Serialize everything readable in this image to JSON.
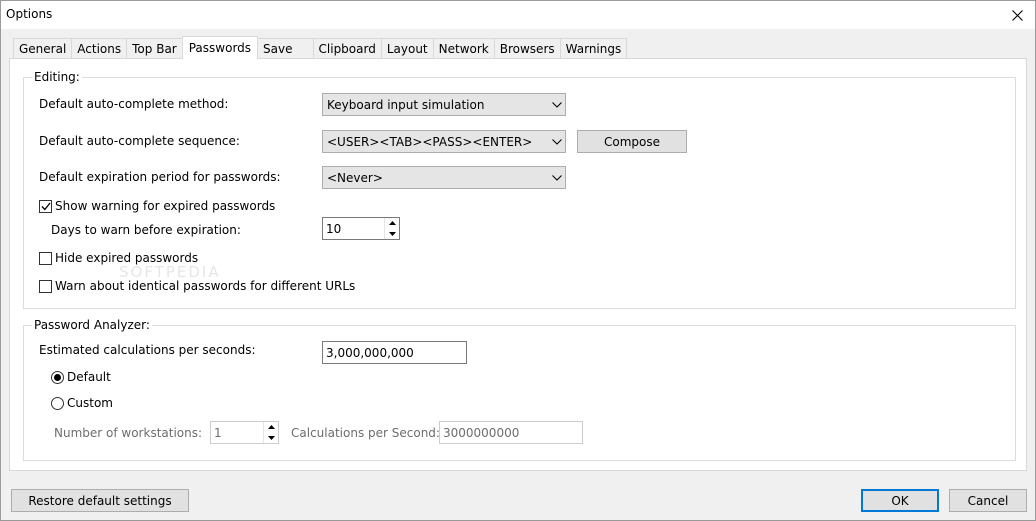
{
  "window": {
    "title": "Options"
  },
  "tabs": [
    {
      "label": "General",
      "active": false
    },
    {
      "label": "Actions",
      "active": false
    },
    {
      "label": "Top Bar",
      "active": false
    },
    {
      "label": "Passwords",
      "active": true
    },
    {
      "label": "Save",
      "active": false
    },
    {
      "label": "Clipboard",
      "active": false
    },
    {
      "label": "Layout",
      "active": false
    },
    {
      "label": "Network",
      "active": false
    },
    {
      "label": "Browsers",
      "active": false
    },
    {
      "label": "Warnings",
      "active": false
    }
  ],
  "editing": {
    "group_label": "Editing:",
    "autocomplete_method_label": "Default auto-complete method:",
    "autocomplete_method_value": "Keyboard input simulation",
    "autocomplete_sequence_label": "Default auto-complete sequence:",
    "autocomplete_sequence_value": "<USER><TAB><PASS><ENTER>",
    "compose_label": "Compose",
    "expiration_label": "Default expiration period for passwords:",
    "expiration_value": "<Never>",
    "show_warning_label": "Show warning for expired passwords",
    "show_warning_checked": true,
    "days_warn_label": "Days to warn before expiration:",
    "days_warn_value": "10",
    "hide_expired_label": "Hide expired passwords",
    "hide_expired_checked": false,
    "warn_identical_label": "Warn about identical passwords for different URLs",
    "warn_identical_checked": false
  },
  "analyzer": {
    "group_label": "Password Analyzer:",
    "calc_label": "Estimated calculations per seconds:",
    "calc_value": "3,000,000,000",
    "default_label": "Default",
    "default_selected": true,
    "custom_label": "Custom",
    "custom_selected": false,
    "workstations_label": "Number of workstations:",
    "workstations_value": "1",
    "calc_per_second_label": "Calculations per Second:",
    "calc_per_second_value": "3000000000"
  },
  "footer": {
    "restore_label": "Restore default settings",
    "ok_label": "OK",
    "cancel_label": "Cancel"
  },
  "watermark": "SOFTPEDIA",
  "colors": {
    "accent": "#0078d7",
    "panel_bg": "#ffffff",
    "window_bg": "#f0f0f0"
  }
}
